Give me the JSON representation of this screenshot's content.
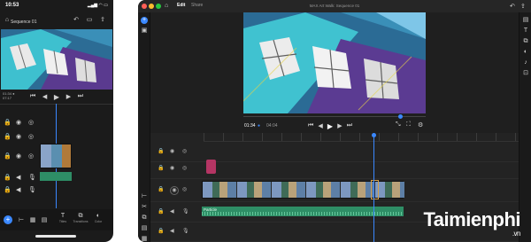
{
  "phone": {
    "time": "10:53",
    "status_icons": "▂▄▆ ◠ ▭",
    "sequence_name": "Sequence 01",
    "timecode": "01:34 ●",
    "duration": "07:17",
    "transport_icons": {
      "prev": "⏮",
      "back": "◀",
      "play": "▶",
      "fwd": "▶",
      "next": "⏭"
    },
    "tabs": [
      {
        "label": "Titles",
        "glyph": "T"
      },
      {
        "label": "Transitions",
        "glyph": "⧉"
      },
      {
        "label": "Color",
        "glyph": "◐"
      }
    ]
  },
  "tablet": {
    "tab_edit": "Edit",
    "tab_share": "Share",
    "window_title": "MAX Art Walk: Sequence 01",
    "timecode": "01:34",
    "timecode_suffix": "●",
    "duration": "04:04",
    "audio_label": "Particle",
    "colors": {
      "accent": "#3b88ff",
      "audio": "#2e8e66",
      "pink_clip": "#b53564"
    }
  },
  "watermark": {
    "brand": "Taimienphi",
    "suffix": ".vn"
  }
}
